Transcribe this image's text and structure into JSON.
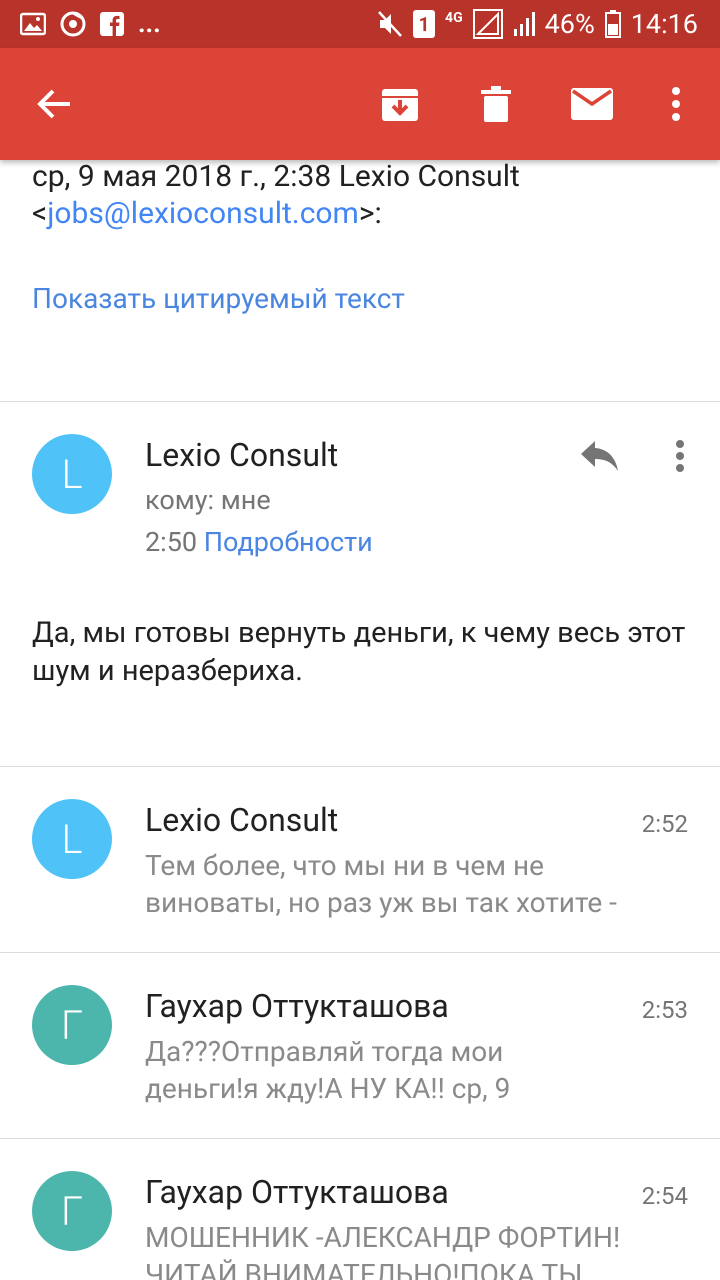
{
  "status_bar": {
    "notification_count": "1",
    "network": "4G",
    "battery": "46%",
    "time": "14:16",
    "more": "..."
  },
  "toolbar": {
    "icons": [
      "back-arrow-icon",
      "archive-icon",
      "delete-icon",
      "mark-unread-icon",
      "more-vert-icon"
    ]
  },
  "quoted_header": {
    "text": "ср, 9 мая 2018 г., 2:38 Lexio Consult",
    "open_bracket": "<",
    "email": "jobs@lexioconsult.com",
    "close": ">:"
  },
  "show_quoted_label": "Показать цитируемый текст",
  "expanded_message": {
    "avatar_letter": "L",
    "sender": "Lexio Consult",
    "to": "кому: мне",
    "time": "2:50",
    "details_label": "Подробности",
    "body": "Да, мы готовы вернуть деньги, к чему весь этот шум и неразбериха."
  },
  "collapsed_messages": [
    {
      "avatar_letter": "L",
      "sender": "Lexio Consult",
      "time": "2:52",
      "snippet_line1": "Тем более, что мы ни в чем не",
      "snippet_line2": "виноваты, но раз уж вы так хотите -"
    },
    {
      "avatar_letter": "Г",
      "sender": "Гаухар Оттукташова",
      "time": "2:53",
      "snippet_line1": "Да???Отправляй тогда мои",
      "snippet_line2": "деньги!я жду!А НУ КА!! ср, 9"
    },
    {
      "avatar_letter": "Г",
      "sender": "Гаухар Оттукташова",
      "time": "2:54",
      "snippet_line1": "МОШЕННИК -АЛЕКСАНДР ФОРТИН!",
      "snippet_line2": "ЧИТАЙ ВНИМАТЕЛЬНО!ПОКА ТЫ"
    }
  ],
  "colors": {
    "status_bar": "#b8332a",
    "toolbar": "#db4437",
    "link": "#4a86e0",
    "avatar_blue": "#4fc3f7",
    "avatar_teal": "#4db6ac"
  }
}
